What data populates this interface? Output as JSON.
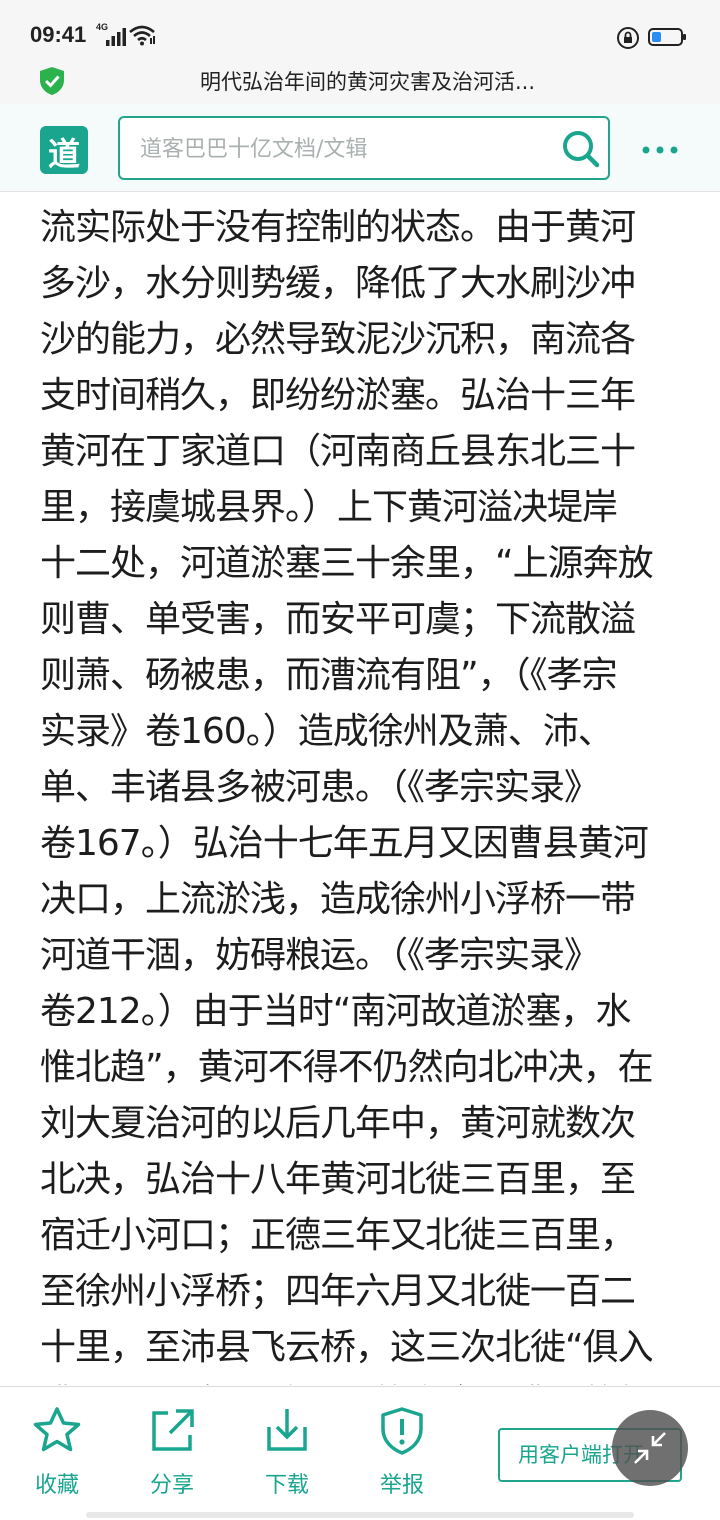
{
  "status_bar": {
    "time": "09:41",
    "network": "4G",
    "icons": [
      "signal-icon",
      "wifi-icon",
      "rotation-lock-icon",
      "battery-icon"
    ]
  },
  "title_bar": {
    "title": "明代弘治年间的黄河灾害及治河活...",
    "icon": "shield-check-icon"
  },
  "header": {
    "logo_text": "道",
    "search_placeholder": "道客巴巴十亿文档/文辑",
    "icons": [
      "search-icon",
      "more-icon"
    ]
  },
  "document": {
    "lines": [
      "流实际处于没有控制的状态。由于黄河",
      "多沙，水分则势缓，降低了大水刷沙冲",
      "沙的能力，必然导致泥沙沉积，南流各",
      "支时间稍久，即纷纷淤塞。弘治十三年",
      "黄河在丁家道口（河南商丘县东北三十",
      "里，接虞城县界。）上下黄河溢决堤岸",
      "十二处，河道淤塞三十余里，“上源奔放",
      "则曹、单受害，而安平可虞；下流散溢",
      "则萧、砀被患，而漕流有阻”，（《孝宗",
      "实录》卷160。）造成徐州及萧、沛、",
      "单、丰诸县多被河患。（《孝宗实录》",
      "卷167。）弘治十七年五月又因曹县黄河",
      "决口，上流淤浅，造成徐州小浮桥一带",
      "河道干涸，妨碍粮运。（《孝宗实录》",
      "卷212。）由于当时“南河故道淤塞，水",
      "惟北趋”，黄河不得不仍然向北冲决，在",
      "刘大夏治河的以后几年中，黄河就数次",
      "北决，弘治十八年黄河北徙三百里，至",
      "宿迁小河口；正德三年又北徙三百里，",
      "至徐州小浮桥；四年六月又北徙一百二",
      "十里，至沛县飞云桥，这三次北徙“俱入",
      "漕河”，仍然影响运河的安全和漕运的畅"
    ]
  },
  "bottom_bar": {
    "favorite_label": "收藏",
    "share_label": "分享",
    "download_label": "下载",
    "report_label": "举报",
    "open_app_label": "用客户端打开"
  },
  "colors": {
    "accent": "#1aa58f",
    "text": "#1d1d1d",
    "statusbar_bg": "#f6f6f6",
    "header_bg": "#f5fbfa"
  }
}
